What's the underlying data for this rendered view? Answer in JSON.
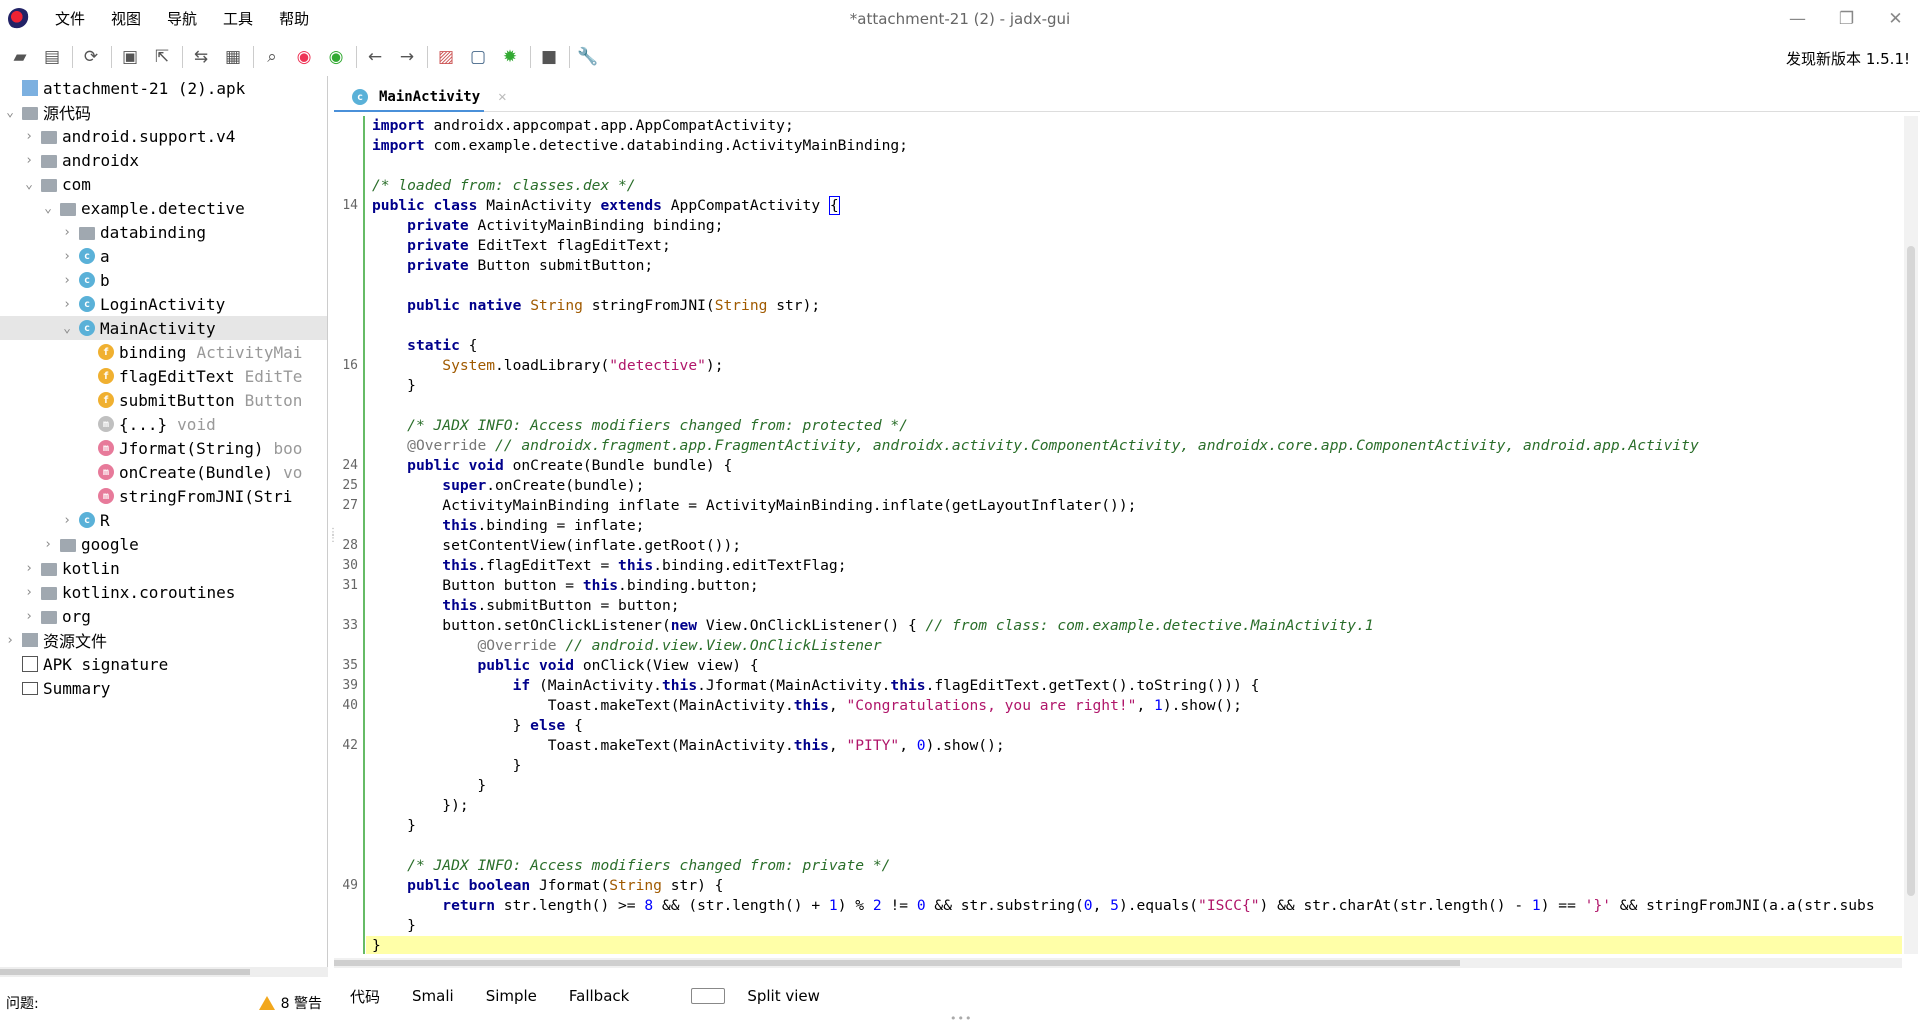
{
  "window": {
    "title": "*attachment-21 (2) - jadx-gui",
    "controls": [
      "—",
      "❐",
      "✕"
    ]
  },
  "menu": [
    "文件",
    "视图",
    "导航",
    "工具",
    "帮助"
  ],
  "update_note": "发现新版本 1.5.1!",
  "toolbar_icons": [
    "open-icon",
    "add-file-icon",
    "refresh-icon",
    "save-icon",
    "export-icon",
    "sync-icon",
    "flatten-icon",
    "search-icon",
    "find-class-icon",
    "find-usage-icon",
    "back-icon",
    "forward-icon",
    "decompile-icon",
    "quark-icon",
    "debug-icon",
    "log-icon",
    "settings-icon"
  ],
  "tree": [
    {
      "depth": 0,
      "chevron": "",
      "icon": "apk",
      "label": "attachment-21 (2).apk",
      "type": ""
    },
    {
      "depth": 0,
      "chevron": "⌄",
      "icon": "pkg",
      "label": "源代码",
      "type": ""
    },
    {
      "depth": 1,
      "chevron": "›",
      "icon": "pkg",
      "label": "android.support.v4",
      "type": ""
    },
    {
      "depth": 1,
      "chevron": "›",
      "icon": "pkg",
      "label": "androidx",
      "type": ""
    },
    {
      "depth": 1,
      "chevron": "⌄",
      "icon": "pkg",
      "label": "com",
      "type": ""
    },
    {
      "depth": 2,
      "chevron": "⌄",
      "icon": "pkg",
      "label": "example.detective",
      "type": ""
    },
    {
      "depth": 3,
      "chevron": "›",
      "icon": "pkg",
      "label": "databinding",
      "type": ""
    },
    {
      "depth": 3,
      "chevron": "›",
      "icon": "cls",
      "label": "a",
      "type": ""
    },
    {
      "depth": 3,
      "chevron": "›",
      "icon": "cls",
      "label": "b",
      "type": ""
    },
    {
      "depth": 3,
      "chevron": "›",
      "icon": "cls",
      "label": "LoginActivity",
      "type": ""
    },
    {
      "depth": 3,
      "chevron": "⌄",
      "icon": "cls",
      "label": "MainActivity",
      "type": "",
      "selected": true
    },
    {
      "depth": 4,
      "chevron": "",
      "icon": "fld",
      "label": "binding",
      "type": "ActivityMai"
    },
    {
      "depth": 4,
      "chevron": "",
      "icon": "fld",
      "label": "flagEditText",
      "type": "EditTe"
    },
    {
      "depth": 4,
      "chevron": "",
      "icon": "fld",
      "label": "submitButton",
      "type": "Button"
    },
    {
      "depth": 4,
      "chevron": "",
      "icon": "mth-g",
      "label": "{...}",
      "type": "void"
    },
    {
      "depth": 4,
      "chevron": "",
      "icon": "mth",
      "label": "Jformat(String)",
      "type": "boo"
    },
    {
      "depth": 4,
      "chevron": "",
      "icon": "mth",
      "label": "onCreate(Bundle)",
      "type": "vo"
    },
    {
      "depth": 4,
      "chevron": "",
      "icon": "mth",
      "label": "stringFromJNI(Stri",
      "type": ""
    },
    {
      "depth": 3,
      "chevron": "›",
      "icon": "cls",
      "label": "R",
      "type": ""
    },
    {
      "depth": 2,
      "chevron": "›",
      "icon": "pkg",
      "label": "google",
      "type": ""
    },
    {
      "depth": 1,
      "chevron": "›",
      "icon": "pkg",
      "label": "kotlin",
      "type": ""
    },
    {
      "depth": 1,
      "chevron": "›",
      "icon": "pkg",
      "label": "kotlinx.coroutines",
      "type": ""
    },
    {
      "depth": 1,
      "chevron": "›",
      "icon": "pkg",
      "label": "org",
      "type": ""
    },
    {
      "depth": 0,
      "chevron": "›",
      "icon": "res",
      "label": "资源文件",
      "type": ""
    },
    {
      "depth": 0,
      "chevron": "",
      "icon": "sig",
      "label": "APK signature",
      "type": ""
    },
    {
      "depth": 0,
      "chevron": "",
      "icon": "sum",
      "label": "Summary",
      "type": ""
    }
  ],
  "problems": {
    "label": "问题:",
    "warnings": "8 警告"
  },
  "editor_tab": {
    "label": "MainActivity",
    "close": "✕"
  },
  "code_lines": [
    {
      "ln": "",
      "html": "<span class=\"kw\">import</span> androidx.appcompat.app.AppCompatActivity;"
    },
    {
      "ln": "",
      "html": "<span class=\"kw\">import</span> com.example.detective.databinding.ActivityMainBinding;"
    },
    {
      "ln": "",
      "html": ""
    },
    {
      "ln": "",
      "html": "<span class=\"cm\">/* loaded from: classes.dex */</span>"
    },
    {
      "ln": "14",
      "html": "<span class=\"kw\">public class</span> MainActivity <span class=\"kw\">extends</span> AppCompatActivity <span style=\"border:1px solid #00f\">{</span>"
    },
    {
      "ln": "",
      "html": "    <span class=\"kw\">private</span> ActivityMainBinding binding;"
    },
    {
      "ln": "",
      "html": "    <span class=\"kw\">private</span> EditText flagEditText;"
    },
    {
      "ln": "",
      "html": "    <span class=\"kw\">private</span> Button submitButton;"
    },
    {
      "ln": "",
      "html": ""
    },
    {
      "ln": "",
      "html": "    <span class=\"kw\">public native</span> <span class=\"ty\">String</span> stringFromJNI(<span class=\"ty\">String</span> str);"
    },
    {
      "ln": "",
      "html": ""
    },
    {
      "ln": "",
      "html": "    <span class=\"kw\">static</span> {"
    },
    {
      "ln": "16",
      "html": "        <span class=\"ty\">System</span>.loadLibrary(<span class=\"str\">\"detective\"</span>);"
    },
    {
      "ln": "",
      "html": "    }"
    },
    {
      "ln": "",
      "html": ""
    },
    {
      "ln": "",
      "html": "    <span class=\"cm\">/* JADX INFO: Access modifiers changed from: protected */</span>"
    },
    {
      "ln": "",
      "html": "    <span class=\"ann\">@Override</span> <span class=\"cm\">// androidx.fragment.app.FragmentActivity, androidx.activity.ComponentActivity, androidx.core.app.ComponentActivity, android.app.Activity</span>"
    },
    {
      "ln": "24",
      "html": "    <span class=\"kw\">public void</span> onCreate(Bundle bundle) {"
    },
    {
      "ln": "25",
      "html": "        <span class=\"kw\">super</span>.onCreate(bundle);"
    },
    {
      "ln": "27",
      "html": "        ActivityMainBinding inflate = ActivityMainBinding.inflate(getLayoutInflater());"
    },
    {
      "ln": "",
      "html": "        <span class=\"kw\">this</span>.binding = inflate;"
    },
    {
      "ln": "28",
      "html": "        setContentView(inflate.getRoot());"
    },
    {
      "ln": "30",
      "html": "        <span class=\"kw\">this</span>.flagEditText = <span class=\"kw\">this</span>.binding.editTextFlag;"
    },
    {
      "ln": "31",
      "html": "        Button button = <span class=\"kw\">this</span>.binding.button;"
    },
    {
      "ln": "",
      "html": "        <span class=\"kw\">this</span>.submitButton = button;"
    },
    {
      "ln": "33",
      "html": "        button.setOnClickListener(<span class=\"kw\">new</span> View.OnClickListener() { <span class=\"cm\">// from class: com.example.detective.MainActivity.1</span>"
    },
    {
      "ln": "",
      "html": "            <span class=\"ann\">@Override</span> <span class=\"cm\">// android.view.View.OnClickListener</span>"
    },
    {
      "ln": "35",
      "html": "            <span class=\"kw\">public void</span> onClick(View view) {"
    },
    {
      "ln": "39",
      "html": "                <span class=\"kw\">if</span> (MainActivity.<span class=\"kw\">this</span>.Jformat(MainActivity.<span class=\"kw\">this</span>.flagEditText.getText().toString())) {"
    },
    {
      "ln": "40",
      "html": "                    Toast.makeText(MainActivity.<span class=\"kw\">this</span>, <span class=\"str\">\"Congratulations, you are right!\"</span>, <span class=\"num\">1</span>).show();"
    },
    {
      "ln": "",
      "html": "                } <span class=\"kw\">else</span> {"
    },
    {
      "ln": "42",
      "html": "                    Toast.makeText(MainActivity.<span class=\"kw\">this</span>, <span class=\"str\">\"PITY\"</span>, <span class=\"num\">0</span>).show();"
    },
    {
      "ln": "",
      "html": "                }"
    },
    {
      "ln": "",
      "html": "            }"
    },
    {
      "ln": "",
      "html": "        });"
    },
    {
      "ln": "",
      "html": "    }"
    },
    {
      "ln": "",
      "html": ""
    },
    {
      "ln": "",
      "html": "    <span class=\"cm\">/* JADX INFO: Access modifiers changed from: private */</span>"
    },
    {
      "ln": "49",
      "html": "    <span class=\"kw\">public boolean</span> Jformat(<span class=\"ty\">String</span> str) {"
    },
    {
      "ln": "",
      "html": "        <span class=\"kw\">return</span> str.length() &gt;= <span class=\"num\">8</span> &amp;&amp; (str.length() + <span class=\"num\">1</span>) % <span class=\"num\">2</span> != <span class=\"num\">0</span> &amp;&amp; str.substring(<span class=\"num\">0</span>, <span class=\"num\">5</span>).equals(<span class=\"str\">\"ISCC{\"</span>) &amp;&amp; str.charAt(str.length() - <span class=\"num\">1</span>) == <span class=\"str\">'}'</span> &amp;&amp; stringFromJNI(a.a(str.subs"
    },
    {
      "ln": "",
      "html": "    }"
    },
    {
      "ln": "",
      "html": "}",
      "hl": true
    }
  ],
  "bottom_tabs": [
    "代码",
    "Smali",
    "Simple",
    "Fallback"
  ],
  "split_view": "Split view"
}
